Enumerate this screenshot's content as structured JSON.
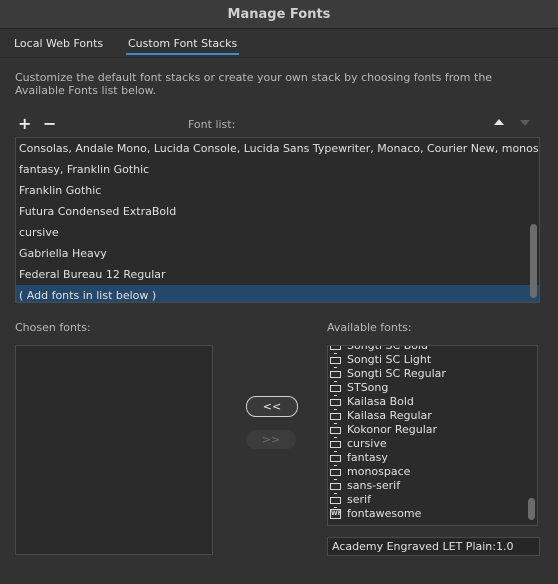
{
  "window": {
    "title": "Manage Fonts"
  },
  "tabs": [
    {
      "label": "Local Web Fonts",
      "active": false
    },
    {
      "label": "Custom Font Stacks",
      "active": true
    }
  ],
  "description": "Customize the default font stacks or create your own stack by choosing fonts from the Available Fonts list below.",
  "font_list": {
    "label": "Font list:",
    "add_icon": "plus-icon",
    "remove_icon": "minus-icon",
    "move_up_icon": "triangle-up-icon",
    "move_down_icon": "triangle-down-icon",
    "items": [
      "Consolas, Andale Mono, Lucida Console, Lucida Sans Typewriter, Monaco, Courier New, monospace",
      "fantasy, Franklin Gothic",
      "Franklin Gothic",
      "Futura Condensed ExtraBold",
      "cursive",
      "Gabriella Heavy",
      "Federal Bureau 12 Regular",
      "( Add fonts in list below )"
    ],
    "selected_index": 7
  },
  "chosen_fonts": {
    "label": "Chosen fonts:",
    "items": []
  },
  "buttons": {
    "add": "<<",
    "remove": ">>"
  },
  "available_fonts": {
    "label": "Available fonts:",
    "items": [
      {
        "name": "Songti SC Bold",
        "icon": "monitor-icon"
      },
      {
        "name": "Songti SC Light",
        "icon": "monitor-icon"
      },
      {
        "name": "Songti SC Regular",
        "icon": "monitor-icon"
      },
      {
        "name": "STSong",
        "icon": "monitor-icon"
      },
      {
        "name": "Kailasa Bold",
        "icon": "monitor-icon"
      },
      {
        "name": "Kailasa Regular",
        "icon": "monitor-icon"
      },
      {
        "name": "Kokonor Regular",
        "icon": "monitor-icon"
      },
      {
        "name": "cursive",
        "icon": "monitor-icon"
      },
      {
        "name": "fantasy",
        "icon": "monitor-icon"
      },
      {
        "name": "monospace",
        "icon": "monitor-icon"
      },
      {
        "name": "sans-serif",
        "icon": "monitor-icon"
      },
      {
        "name": "serif",
        "icon": "monitor-icon"
      },
      {
        "name": "fontawesome",
        "icon": "web-font-icon"
      }
    ]
  },
  "preview_field": {
    "value": "Academy Engraved LET Plain:1.0"
  },
  "colors": {
    "accent": "#3a8ad8",
    "selection": "#244869"
  }
}
